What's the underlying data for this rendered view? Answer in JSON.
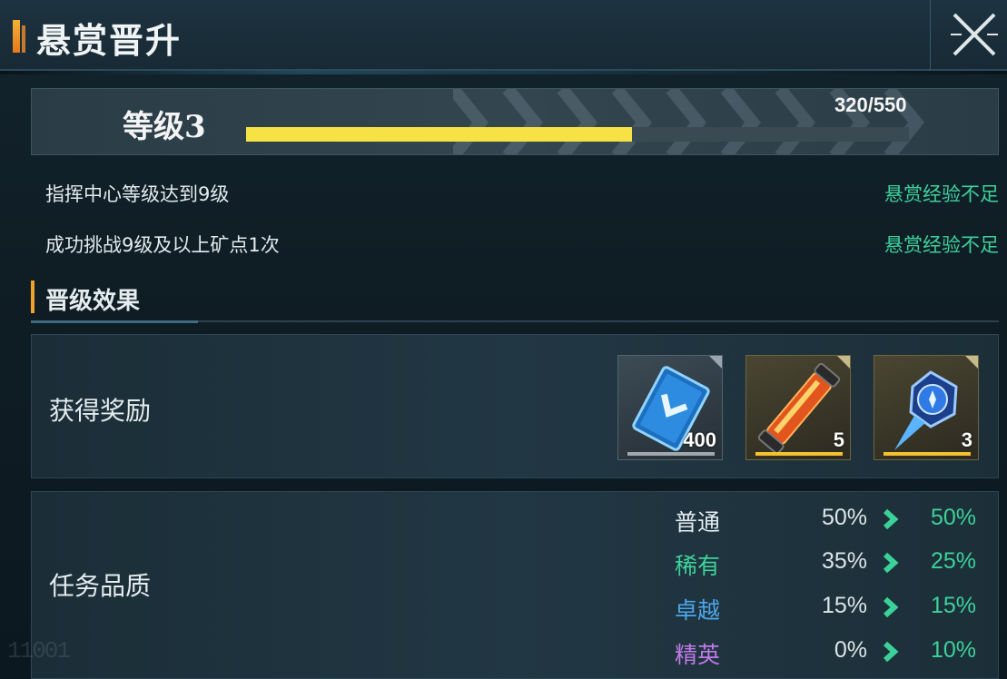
{
  "header": {
    "title": "悬赏晋升",
    "close_icon": "close-x-icon"
  },
  "level": {
    "label": "等级3",
    "progress_text": "320/550",
    "progress_current": 320,
    "progress_max": 550,
    "bar_color": "#f7e246"
  },
  "requirements": [
    {
      "text": "指挥中心等级达到9级",
      "status": "悬赏经验不足"
    },
    {
      "text": "成功挑战9级及以上矿点1次",
      "status": "悬赏经验不足"
    }
  ],
  "section": {
    "title": "晋级效果"
  },
  "rewards": {
    "label": "获得奖励",
    "items": [
      {
        "icon": "blue-card-chevron-icon",
        "count": "400",
        "frame": "grey"
      },
      {
        "icon": "orange-energy-tube-icon",
        "count": "5",
        "frame": "gold"
      },
      {
        "icon": "blue-crystal-shard-icon",
        "count": "3",
        "frame": "gold"
      }
    ]
  },
  "quality": {
    "label": "任务品质",
    "rows": [
      {
        "name": "普通",
        "from": "50%",
        "to": "50%",
        "color": "#e4ecee"
      },
      {
        "name": "稀有",
        "from": "35%",
        "to": "25%",
        "color": "#3dd19a"
      },
      {
        "name": "卓越",
        "from": "15%",
        "to": "15%",
        "color": "#4da6ea"
      },
      {
        "name": "精英",
        "from": "0%",
        "to": "10%",
        "color": "#c07ae8"
      }
    ]
  },
  "watermark": "11001",
  "colors": {
    "accent_green": "#3dd19a",
    "accent_orange": "#f0a22a",
    "progress_yellow": "#f7e246"
  }
}
